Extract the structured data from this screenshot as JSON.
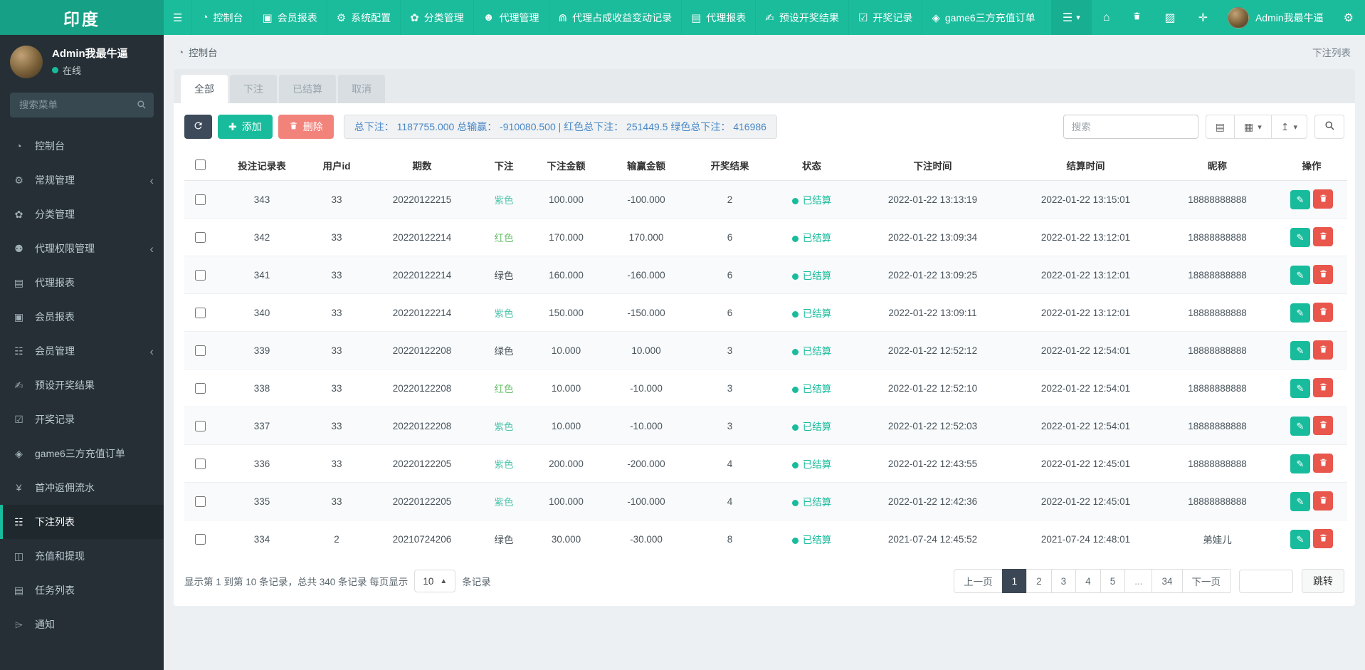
{
  "brand": {
    "logo": "印度"
  },
  "colors": {
    "accent": "#18bc9c",
    "navbar": "#1abc9c",
    "logo_bg": "#16a085",
    "sidebar_bg": "#252f35",
    "dark_button": "#3d4a5a",
    "delete_salmon": "#f2837b",
    "danger_red": "#e8564c",
    "stats_blue": "#4a88c7"
  },
  "topnav": {
    "menu": [
      {
        "label": "控制台",
        "icon": "dashboard-icon"
      },
      {
        "label": "会员报表",
        "icon": "id-card-icon"
      },
      {
        "label": "系统配置",
        "icon": "gear-icon"
      },
      {
        "label": "分类管理",
        "icon": "leaf-icon"
      },
      {
        "label": "代理管理",
        "icon": "user-icon"
      },
      {
        "label": "代理占成收益变动记录",
        "icon": "binoculars-icon"
      },
      {
        "label": "代理报表",
        "icon": "book-icon"
      },
      {
        "label": "预设开奖结果",
        "icon": "pencil-icon"
      },
      {
        "label": "开奖记录",
        "icon": "calendar-check-icon"
      },
      {
        "label": "game6三方充值订单",
        "icon": "gem-icon"
      }
    ],
    "right_buttons": [
      {
        "name": "menu-dropdown-button",
        "icon": "hamburger-icon",
        "caret": true
      },
      {
        "name": "home-button",
        "icon": "home-icon"
      },
      {
        "name": "trash-button",
        "icon": "trash-icon"
      },
      {
        "name": "logs-button",
        "icon": "logs-icon"
      },
      {
        "name": "fullscreen-button",
        "icon": "fullscreen-icon"
      }
    ],
    "user_name": "Admin我最牛逼",
    "settings_icon": "gears-icon"
  },
  "sidebar": {
    "user": {
      "name": "Admin我最牛逼",
      "status": "在线"
    },
    "search_placeholder": "搜索菜单",
    "menu": [
      {
        "label": "控制台",
        "icon": "dashboard-icon"
      },
      {
        "label": "常规管理",
        "icon": "gears-icon",
        "has_children": true
      },
      {
        "label": "分类管理",
        "icon": "leaf-icon"
      },
      {
        "label": "代理权限管理",
        "icon": "users-icon",
        "has_children": true
      },
      {
        "label": "代理报表",
        "icon": "book-icon"
      },
      {
        "label": "会员报表",
        "icon": "id-card-icon"
      },
      {
        "label": "会员管理",
        "icon": "list-icon",
        "has_children": true
      },
      {
        "label": "预设开奖结果",
        "icon": "pencil-icon"
      },
      {
        "label": "开奖记录",
        "icon": "calendar-check-icon"
      },
      {
        "label": "game6三方充值订单",
        "icon": "gem-icon"
      },
      {
        "label": "首冲返佣流水",
        "icon": "yen-icon"
      },
      {
        "label": "下注列表",
        "icon": "list-icon",
        "active": true
      },
      {
        "label": "充值和提现",
        "icon": "money-icon"
      },
      {
        "label": "任务列表",
        "icon": "book-icon"
      },
      {
        "label": "通知",
        "icon": "megaphone-icon"
      }
    ]
  },
  "header": {
    "breadcrumb": "控制台",
    "page_title": "下注列表"
  },
  "tabs": [
    {
      "label": "全部",
      "active": true
    },
    {
      "label": "下注"
    },
    {
      "label": "已结算"
    },
    {
      "label": "取消"
    }
  ],
  "toolbar": {
    "add_label": "添加",
    "delete_label": "删除",
    "stats": "总下注： 1187755.000 总输赢： -910080.500 | 红色总下注： 251449.5 绿色总下注： 416986",
    "search_placeholder": "搜索",
    "view_buttons": [
      {
        "name": "toggle-columns-button",
        "icon": "columns-icon"
      },
      {
        "name": "grid-view-button",
        "icon": "grid-icon",
        "caret": true
      },
      {
        "name": "export-button",
        "icon": "export-icon",
        "caret": true
      }
    ]
  },
  "table": {
    "columns": [
      "投注记录表",
      "用户id",
      "期数",
      "下注",
      "下注金额",
      "输赢金额",
      "开奖结果",
      "状态",
      "下注时间",
      "结算时间",
      "昵称",
      "操作"
    ],
    "rows": [
      {
        "record_id": "343",
        "user_id": "33",
        "period": "20220122215",
        "bet": "紫色",
        "bet_color": "teal",
        "amount": "100.000",
        "winloss": "-100.000",
        "result": "2",
        "status": "已结算",
        "bet_time": "2022-01-22 13:13:19",
        "settle_time": "2022-01-22 13:15:01",
        "nickname": "18888888888"
      },
      {
        "record_id": "342",
        "user_id": "33",
        "period": "20220122214",
        "bet": "红色",
        "bet_color": "green",
        "amount": "170.000",
        "winloss": "170.000",
        "result": "6",
        "status": "已结算",
        "bet_time": "2022-01-22 13:09:34",
        "settle_time": "2022-01-22 13:12:01",
        "nickname": "18888888888"
      },
      {
        "record_id": "341",
        "user_id": "33",
        "period": "20220122214",
        "bet": "绿色",
        "bet_color": "dark",
        "amount": "160.000",
        "winloss": "-160.000",
        "result": "6",
        "status": "已结算",
        "bet_time": "2022-01-22 13:09:25",
        "settle_time": "2022-01-22 13:12:01",
        "nickname": "18888888888"
      },
      {
        "record_id": "340",
        "user_id": "33",
        "period": "20220122214",
        "bet": "紫色",
        "bet_color": "teal",
        "amount": "150.000",
        "winloss": "-150.000",
        "result": "6",
        "status": "已结算",
        "bet_time": "2022-01-22 13:09:11",
        "settle_time": "2022-01-22 13:12:01",
        "nickname": "18888888888"
      },
      {
        "record_id": "339",
        "user_id": "33",
        "period": "20220122208",
        "bet": "绿色",
        "bet_color": "dark",
        "amount": "10.000",
        "winloss": "10.000",
        "result": "3",
        "status": "已结算",
        "bet_time": "2022-01-22 12:52:12",
        "settle_time": "2022-01-22 12:54:01",
        "nickname": "18888888888"
      },
      {
        "record_id": "338",
        "user_id": "33",
        "period": "20220122208",
        "bet": "红色",
        "bet_color": "green",
        "amount": "10.000",
        "winloss": "-10.000",
        "result": "3",
        "status": "已结算",
        "bet_time": "2022-01-22 12:52:10",
        "settle_time": "2022-01-22 12:54:01",
        "nickname": "18888888888"
      },
      {
        "record_id": "337",
        "user_id": "33",
        "period": "20220122208",
        "bet": "紫色",
        "bet_color": "teal",
        "amount": "10.000",
        "winloss": "-10.000",
        "result": "3",
        "status": "已结算",
        "bet_time": "2022-01-22 12:52:03",
        "settle_time": "2022-01-22 12:54:01",
        "nickname": "18888888888"
      },
      {
        "record_id": "336",
        "user_id": "33",
        "period": "20220122205",
        "bet": "紫色",
        "bet_color": "teal",
        "amount": "200.000",
        "winloss": "-200.000",
        "result": "4",
        "status": "已结算",
        "bet_time": "2022-01-22 12:43:55",
        "settle_time": "2022-01-22 12:45:01",
        "nickname": "18888888888"
      },
      {
        "record_id": "335",
        "user_id": "33",
        "period": "20220122205",
        "bet": "紫色",
        "bet_color": "teal",
        "amount": "100.000",
        "winloss": "-100.000",
        "result": "4",
        "status": "已结算",
        "bet_time": "2022-01-22 12:42:36",
        "settle_time": "2022-01-22 12:45:01",
        "nickname": "18888888888"
      },
      {
        "record_id": "334",
        "user_id": "2",
        "period": "20210724206",
        "bet": "绿色",
        "bet_color": "dark",
        "amount": "30.000",
        "winloss": "-30.000",
        "result": "8",
        "status": "已结算",
        "bet_time": "2021-07-24 12:45:52",
        "settle_time": "2021-07-24 12:48:01",
        "nickname": "弟娃儿"
      }
    ]
  },
  "footer": {
    "summary_prefix": "显示第 1 到第 10 条记录，总共 340 条记录 每页显示",
    "page_size": "10",
    "summary_suffix": "条记录",
    "pagination": {
      "prev": "上一页",
      "pages": [
        "1",
        "2",
        "3",
        "4",
        "5",
        "...",
        "34"
      ],
      "active": "1",
      "next": "下一页",
      "jump_label": "跳转"
    }
  }
}
